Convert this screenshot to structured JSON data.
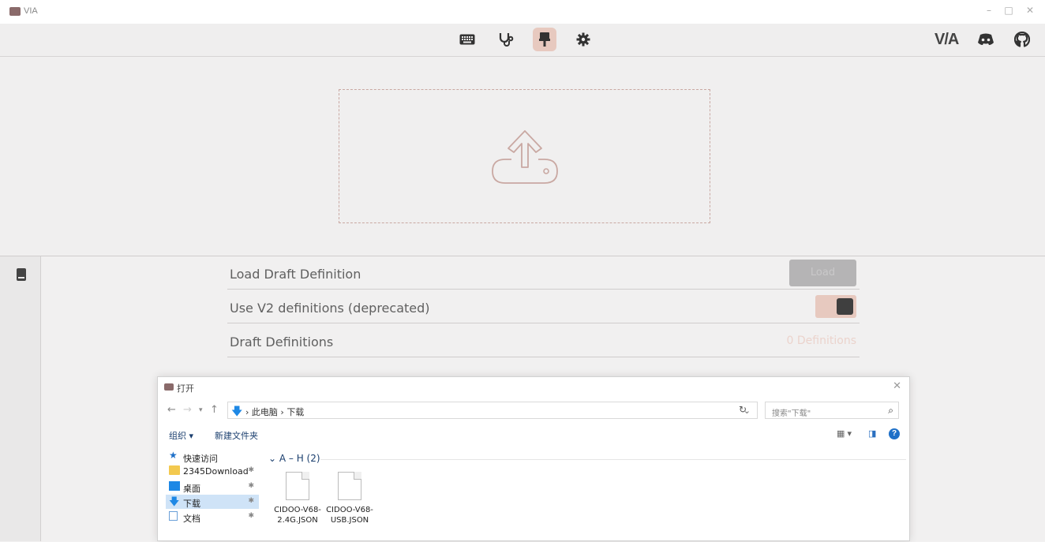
{
  "window": {
    "title": "VIA",
    "controls": {
      "minimize": "–",
      "maximize": "□",
      "close": "✕"
    }
  },
  "topnav": {
    "icons": [
      "keyboard-icon",
      "stethoscope-icon",
      "brush-icon",
      "gear-icon"
    ],
    "active_index": 2,
    "brand_text": "V/A",
    "right_icons": [
      "discord-icon",
      "github-icon"
    ]
  },
  "upload": {
    "icon": "upload-icon"
  },
  "settings": {
    "rows": [
      {
        "label": "Load Draft Definition",
        "button": "Load"
      },
      {
        "label": "Use V2 definitions (deprecated)",
        "toggle_on": true
      },
      {
        "label": "Draft Definitions",
        "count": "0 Definitions"
      }
    ]
  },
  "dialog": {
    "title": "打开",
    "path": [
      "此电脑",
      "下载"
    ],
    "search_placeholder": "搜索\"下载\"",
    "toolbar": {
      "organize": "组织 ▾",
      "new_folder": "新建文件夹"
    },
    "nav_items": [
      {
        "label": "快速访问",
        "icon": "star-icon"
      },
      {
        "label": "2345Download",
        "icon": "folder-icon",
        "pinned": true
      },
      {
        "label": "桌面",
        "icon": "desktop-icon",
        "pinned": true
      },
      {
        "label": "下载",
        "icon": "download-icon",
        "pinned": true,
        "selected": true
      },
      {
        "label": "文档",
        "icon": "document-icon",
        "pinned": true
      }
    ],
    "group_header": "A – H (2)",
    "files": [
      {
        "name": "CIDOO-V68-2.4G.JSON"
      },
      {
        "name": "CIDOO-V68-USB.JSON"
      }
    ],
    "colors": {
      "accent": "#1e88e5",
      "selection": "#cfe3f7"
    }
  },
  "colors": {
    "accent": "#e7c9bf",
    "bg": "#f2f1f1",
    "knob": "#3f3f3f"
  }
}
